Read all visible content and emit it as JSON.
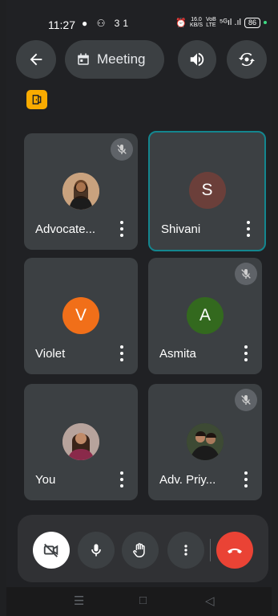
{
  "status_bar": {
    "time": "11:27",
    "notif_icons": "● ⚇ 31",
    "net_speed_top": "16.0",
    "net_speed_bottom": "KB/S",
    "lte_top": "VoB",
    "lte_bottom": "LTE",
    "signal": "⁵ᴳıl .ıl",
    "battery": "86"
  },
  "header": {
    "meeting_title": "Meeting"
  },
  "tiles": [
    {
      "name": "Advocate...",
      "avatar_kind": "photo",
      "avatar_color": "#c9a27e",
      "muted": true
    },
    {
      "name": "Shivani",
      "avatar_letter": "S",
      "avatar_color": "#6b3f3a",
      "muted": false,
      "active": true
    },
    {
      "name": "Violet",
      "avatar_letter": "V",
      "avatar_color": "#f16f19",
      "muted": false
    },
    {
      "name": "Asmita",
      "avatar_letter": "A",
      "avatar_color": "#33691e",
      "muted": true
    },
    {
      "name": "You",
      "avatar_kind": "photo",
      "avatar_color": "#a98f86",
      "muted": false
    },
    {
      "name": "Adv. Priy...",
      "avatar_kind": "photo",
      "avatar_color": "#2f3c2b",
      "muted": true
    }
  ],
  "colors": {
    "background": "#202124",
    "tile": "#3c4043",
    "active_border": "#13868f",
    "end_call": "#ea4335",
    "cast_badge": "#f9ab00"
  },
  "icons": {
    "back": "arrow-left-icon",
    "calendar": "calendar-icon",
    "speaker": "speaker-icon",
    "flip_camera": "flip-camera-icon",
    "camera_off": "camera-off-icon",
    "mic": "mic-icon",
    "hand": "raise-hand-icon",
    "more": "more-vertical-icon",
    "end_call": "end-call-icon"
  },
  "navbar": {
    "menu": "☰",
    "home": "□",
    "back": "◁"
  }
}
